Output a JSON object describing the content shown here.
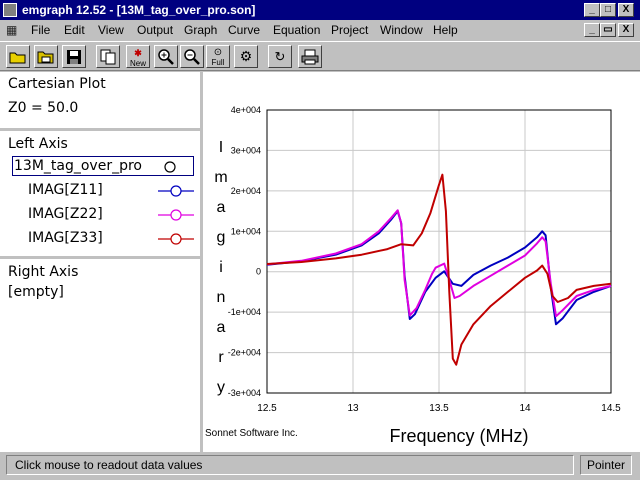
{
  "window": {
    "title": "emgraph 12.52 - [13M_tag_over_pro.son]",
    "controls": [
      "_",
      "□",
      "X"
    ],
    "mdi_controls": [
      "_",
      "▭",
      "X"
    ]
  },
  "menu": [
    "File",
    "Edit",
    "View",
    "Output",
    "Graph",
    "Curve",
    "Equation",
    "Project",
    "Window",
    "Help"
  ],
  "toolbar": {
    "buttons": [
      {
        "name": "open-button",
        "icon": "folder-open-icon",
        "label": ""
      },
      {
        "name": "open-multiple-button",
        "icon": "folder-icon",
        "label": ""
      },
      {
        "name": "save-button",
        "icon": "save-icon",
        "label": ""
      },
      {
        "name": "copy-button",
        "icon": "copy-icon",
        "label": ""
      },
      {
        "name": "new-button",
        "icon": "new-icon",
        "label": "New"
      },
      {
        "name": "zoom-in-button",
        "icon": "zoom-in-icon",
        "label": ""
      },
      {
        "name": "zoom-out-button",
        "icon": "zoom-out-icon",
        "label": ""
      },
      {
        "name": "zoom-full-button",
        "icon": "zoom-full-icon",
        "label": "Full"
      },
      {
        "name": "zoom-settings-button",
        "icon": "gear-zoom-icon",
        "label": ""
      },
      {
        "name": "refresh-button",
        "icon": "refresh-icon",
        "label": ""
      },
      {
        "name": "print-button",
        "icon": "printer-icon",
        "label": ""
      }
    ]
  },
  "left_panel": {
    "plot_type": "Cartesian Plot",
    "z0": "Z0 = 50.0",
    "left_axis_label": "Left Axis",
    "project": "13M_tag_over_pro",
    "curves": [
      {
        "label": "IMAG[Z11]",
        "color": "#0000c0"
      },
      {
        "label": "IMAG[Z22]",
        "color": "#e000e0"
      },
      {
        "label": "IMAG[Z33]",
        "color": "#c00000"
      }
    ],
    "right_axis_label": "Right Axis",
    "right_axis_value": "[empty]"
  },
  "chart_data": {
    "type": "line",
    "xlabel": "Frequency (MHz)",
    "ylabel": "Imaginary",
    "xlim": [
      12.5,
      14.5
    ],
    "ylim": [
      -30000,
      40000
    ],
    "x_ticks": [
      "12.5",
      "13",
      "13.5",
      "14",
      "14.5"
    ],
    "y_ticks": [
      "-3e+004",
      "-2e+004",
      "-1e+004",
      "0",
      "1e+004",
      "2e+004",
      "3e+004",
      "4e+004"
    ],
    "grid": true,
    "watermark": "Sonnet Software Inc.",
    "series": [
      {
        "name": "IMAG[Z11]",
        "color": "#0000c0",
        "points": [
          [
            12.5,
            1700
          ],
          [
            12.7,
            2600
          ],
          [
            12.9,
            4200
          ],
          [
            13.05,
            6500
          ],
          [
            13.15,
            9500
          ],
          [
            13.22,
            12800
          ],
          [
            13.26,
            15000
          ],
          [
            13.28,
            12000
          ],
          [
            13.3,
            -1000
          ],
          [
            13.33,
            -11700
          ],
          [
            13.36,
            -10500
          ],
          [
            13.42,
            -5000
          ],
          [
            13.48,
            -1500
          ],
          [
            13.53,
            100
          ],
          [
            13.58,
            -3000
          ],
          [
            13.63,
            -3500
          ],
          [
            13.7,
            -800
          ],
          [
            13.8,
            1500
          ],
          [
            13.9,
            3500
          ],
          [
            14.0,
            6000
          ],
          [
            14.07,
            8500
          ],
          [
            14.1,
            10000
          ],
          [
            14.12,
            9000
          ],
          [
            14.15,
            -4000
          ],
          [
            14.18,
            -13000
          ],
          [
            14.22,
            -11500
          ],
          [
            14.3,
            -7000
          ],
          [
            14.4,
            -5000
          ],
          [
            14.5,
            -3500
          ]
        ]
      },
      {
        "name": "IMAG[Z22]",
        "color": "#e000e0",
        "points": [
          [
            12.5,
            1800
          ],
          [
            12.7,
            2700
          ],
          [
            12.9,
            4500
          ],
          [
            13.05,
            6800
          ],
          [
            13.15,
            10000
          ],
          [
            13.22,
            13200
          ],
          [
            13.26,
            15200
          ],
          [
            13.28,
            12000
          ],
          [
            13.3,
            -2000
          ],
          [
            13.33,
            -10800
          ],
          [
            13.37,
            -9000
          ],
          [
            13.42,
            -4500
          ],
          [
            13.46,
            -500
          ],
          [
            13.48,
            1000
          ],
          [
            13.53,
            2000
          ],
          [
            13.56,
            -2000
          ],
          [
            13.59,
            -6500
          ],
          [
            13.62,
            -6000
          ],
          [
            13.7,
            -3500
          ],
          [
            13.8,
            -1000
          ],
          [
            13.9,
            1500
          ],
          [
            14.0,
            4000
          ],
          [
            14.07,
            7000
          ],
          [
            14.1,
            8500
          ],
          [
            14.12,
            7500
          ],
          [
            14.15,
            -3000
          ],
          [
            14.18,
            -11000
          ],
          [
            14.22,
            -9500
          ],
          [
            14.3,
            -6000
          ],
          [
            14.4,
            -4500
          ],
          [
            14.5,
            -3500
          ]
        ]
      },
      {
        "name": "IMAG[Z33]",
        "color": "#c00000",
        "points": [
          [
            12.5,
            1900
          ],
          [
            12.7,
            2400
          ],
          [
            12.9,
            3300
          ],
          [
            13.05,
            4200
          ],
          [
            13.2,
            5600
          ],
          [
            13.28,
            6800
          ],
          [
            13.35,
            6500
          ],
          [
            13.4,
            9500
          ],
          [
            13.45,
            14500
          ],
          [
            13.5,
            21500
          ],
          [
            13.52,
            24000
          ],
          [
            13.54,
            15000
          ],
          [
            13.56,
            -5000
          ],
          [
            13.58,
            -21500
          ],
          [
            13.6,
            -23000
          ],
          [
            13.63,
            -18000
          ],
          [
            13.7,
            -13000
          ],
          [
            13.8,
            -8500
          ],
          [
            13.9,
            -5000
          ],
          [
            14.0,
            -1500
          ],
          [
            14.07,
            300
          ],
          [
            14.1,
            1500
          ],
          [
            14.13,
            -500
          ],
          [
            14.16,
            -6000
          ],
          [
            14.19,
            -7500
          ],
          [
            14.25,
            -6500
          ],
          [
            14.3,
            -4500
          ],
          [
            14.4,
            -3500
          ],
          [
            14.5,
            -3000
          ]
        ]
      }
    ]
  },
  "status": {
    "message": "Click mouse to readout data values",
    "mode": "Pointer"
  }
}
